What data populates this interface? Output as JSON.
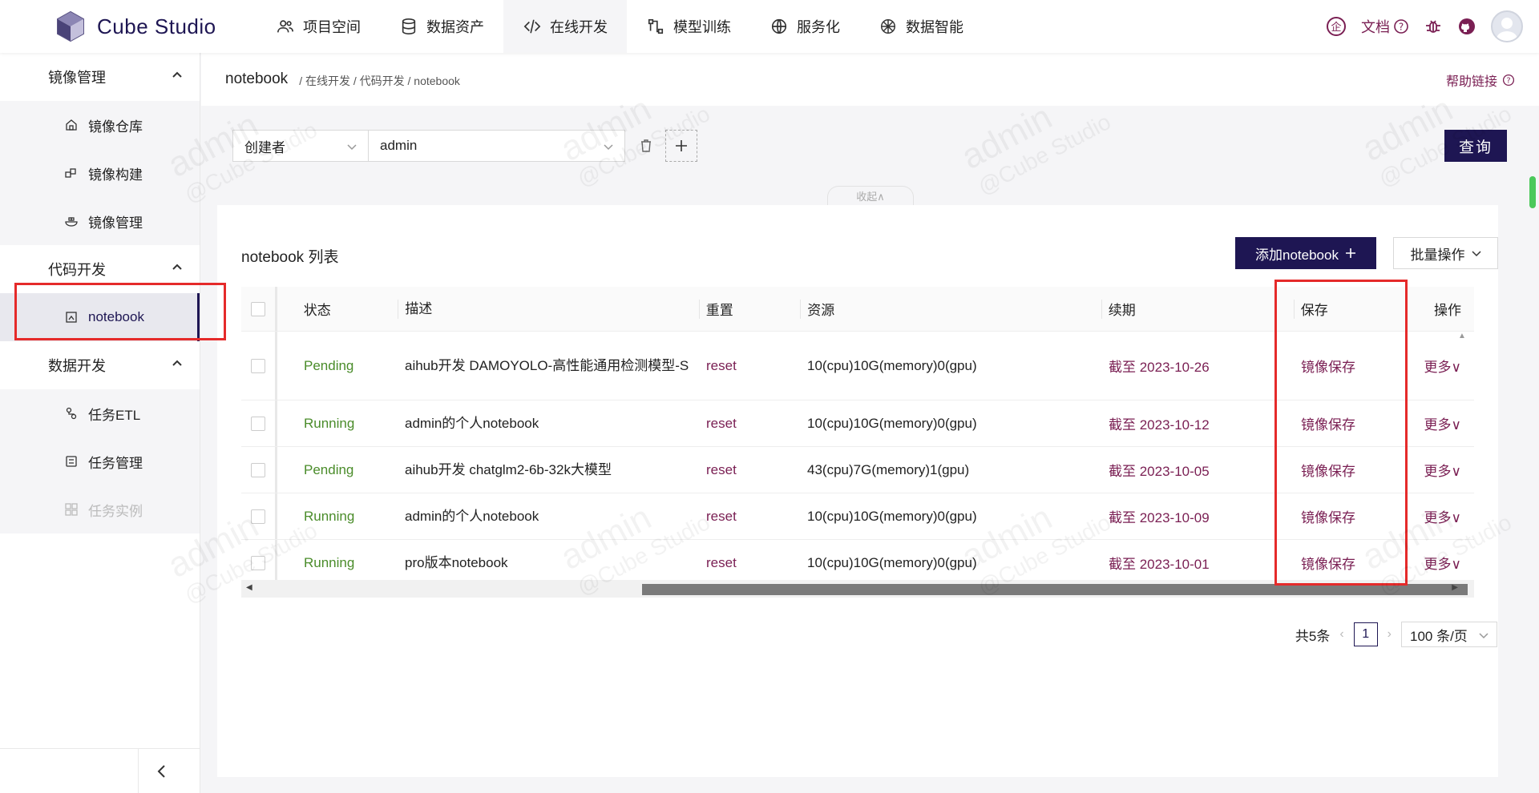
{
  "app": {
    "name": "Cube Studio"
  },
  "nav": [
    {
      "label": "项目空间",
      "icon": "users-icon"
    },
    {
      "label": "数据资产",
      "icon": "database-icon"
    },
    {
      "label": "在线开发",
      "icon": "code-icon",
      "active": true
    },
    {
      "label": "模型训练",
      "icon": "flow-icon"
    },
    {
      "label": "服务化",
      "icon": "globe-icon"
    },
    {
      "label": "数据智能",
      "icon": "ai-icon"
    }
  ],
  "header_right": {
    "docs_label": "文档"
  },
  "sidebar": {
    "groups": [
      {
        "title": "镜像管理",
        "items": [
          {
            "label": "镜像仓库",
            "icon": "image-repo-icon"
          },
          {
            "label": "镜像构建",
            "icon": "image-build-icon"
          },
          {
            "label": "镜像管理",
            "icon": "image-manage-icon"
          }
        ]
      },
      {
        "title": "代码开发",
        "items": [
          {
            "label": "notebook",
            "icon": "notebook-icon",
            "active": true
          }
        ]
      },
      {
        "title": "数据开发",
        "items": [
          {
            "label": "任务ETL",
            "icon": "etl-icon"
          },
          {
            "label": "任务管理",
            "icon": "task-manage-icon"
          },
          {
            "label": "任务实例",
            "icon": "task-instance-icon",
            "disabled": true
          }
        ]
      }
    ]
  },
  "breadcrumb": {
    "title": "notebook",
    "path": "/ 在线开发 / 代码开发 / notebook",
    "help": "帮助链接"
  },
  "filter": {
    "field": "创建者",
    "value": "admin",
    "query_label": "查询",
    "collapse_label": "收起∧"
  },
  "panel": {
    "title": "notebook 列表",
    "add_label": "添加notebook",
    "batch_label": "批量操作"
  },
  "table": {
    "headers": {
      "status": "状态",
      "desc": "描述",
      "reset": "重置",
      "resource": "资源",
      "renew": "续期",
      "save": "保存",
      "action": "操作"
    },
    "rows": [
      {
        "status": "Pending",
        "desc": "aihub开发 DAMOYOLO-高性能通用检测模型-S",
        "reset": "reset",
        "resource": "10(cpu)10G(memory)0(gpu)",
        "renew": "截至 2023-10-26",
        "save": "镜像保存",
        "action": "更多∨"
      },
      {
        "status": "Running",
        "desc": "admin的个人notebook",
        "reset": "reset",
        "resource": "10(cpu)10G(memory)0(gpu)",
        "renew": "截至 2023-10-12",
        "save": "镜像保存",
        "action": "更多∨"
      },
      {
        "status": "Pending",
        "desc": "aihub开发 chatglm2-6b-32k大模型",
        "reset": "reset",
        "resource": "43(cpu)7G(memory)1(gpu)",
        "renew": "截至 2023-10-05",
        "save": "镜像保存",
        "action": "更多∨"
      },
      {
        "status": "Running",
        "desc": "admin的个人notebook",
        "reset": "reset",
        "resource": "10(cpu)10G(memory)0(gpu)",
        "renew": "截至 2023-10-09",
        "save": "镜像保存",
        "action": "更多∨"
      },
      {
        "status": "Running",
        "desc": "pro版本notebook",
        "reset": "reset",
        "resource": "10(cpu)10G(memory)0(gpu)",
        "renew": "截至 2023-10-01",
        "save": "镜像保存",
        "action": "更多∨"
      }
    ]
  },
  "pagination": {
    "total": "共5条",
    "current": "1",
    "page_size": "100 条/页"
  },
  "watermark": {
    "line1": "admin",
    "line2": "@Cube Studio"
  },
  "colors": {
    "brand": "#1e1653",
    "accent": "#7a1f53",
    "status": "#4a8c2a",
    "highlight": "#e52a2a"
  }
}
